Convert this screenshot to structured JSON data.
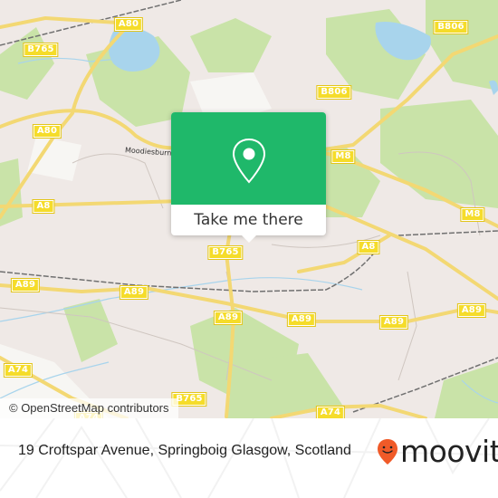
{
  "map": {
    "road_labels": [
      {
        "id": "a80-top",
        "text": "A80"
      },
      {
        "id": "b765-top",
        "text": "B765"
      },
      {
        "id": "b806-right",
        "text": "B806"
      },
      {
        "id": "b806-mid",
        "text": "B806"
      },
      {
        "id": "a80-left",
        "text": "A80"
      },
      {
        "id": "m8-upper",
        "text": "M8"
      },
      {
        "id": "a8-left",
        "text": "A8"
      },
      {
        "id": "m8-right",
        "text": "M8"
      },
      {
        "id": "b765-mid",
        "text": "B765"
      },
      {
        "id": "a8-right",
        "text": "A8"
      },
      {
        "id": "a89-far-left",
        "text": "A89"
      },
      {
        "id": "a89-left",
        "text": "A89"
      },
      {
        "id": "a89-center",
        "text": "A89"
      },
      {
        "id": "a89-mid",
        "text": "A89"
      },
      {
        "id": "a89-right",
        "text": "A89"
      },
      {
        "id": "a89-far-right",
        "text": "A89"
      },
      {
        "id": "a74-left",
        "text": "A74"
      },
      {
        "id": "b765-bottom",
        "text": "B765"
      },
      {
        "id": "a74-bottom",
        "text": "A74"
      },
      {
        "id": "a74-right",
        "text": "A74"
      }
    ],
    "place_label": "Moodiesburn",
    "attribution": "© OpenStreetMap contributors"
  },
  "popup": {
    "icon": "map-pin-icon",
    "button_label": "Take me there",
    "accent_color": "#1fb86a"
  },
  "footer": {
    "address": "19 Croftspar Avenue, Springboig Glasgow, Scotland",
    "brand_name": "moovit",
    "brand_icon": "moovit-pin-logo-icon",
    "brand_color": "#f05a28"
  }
}
